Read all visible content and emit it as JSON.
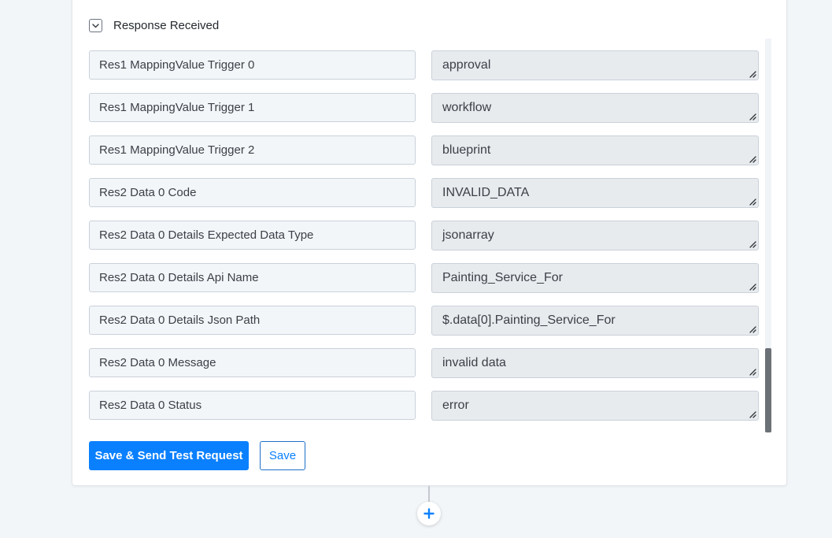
{
  "section": {
    "title": "Response Received"
  },
  "rows": [
    {
      "key": "Res1 MappingValue Trigger 0",
      "value": "approval"
    },
    {
      "key": "Res1 MappingValue Trigger 1",
      "value": "workflow"
    },
    {
      "key": "Res1 MappingValue Trigger 2",
      "value": "blueprint"
    },
    {
      "key": "Res2 Data 0 Code",
      "value": "INVALID_DATA"
    },
    {
      "key": "Res2 Data 0 Details Expected Data Type",
      "value": "jsonarray"
    },
    {
      "key": "Res2 Data 0 Details Api Name",
      "value": "Painting_Service_For"
    },
    {
      "key": "Res2 Data 0 Details Json Path",
      "value": "$.data[0].Painting_Service_For"
    },
    {
      "key": "Res2 Data 0 Message",
      "value": "invalid data"
    },
    {
      "key": "Res2 Data 0 Status",
      "value": "error"
    }
  ],
  "actions": {
    "save_send_label": "Save & Send Test Request",
    "save_label": "Save"
  },
  "icons": {
    "toggle": "chevron-down-icon",
    "add_step": "plus-icon",
    "resize": "resize-grip-icon"
  },
  "colors": {
    "accent": "#0a80ff",
    "page_bg": "#f3f6f9"
  }
}
